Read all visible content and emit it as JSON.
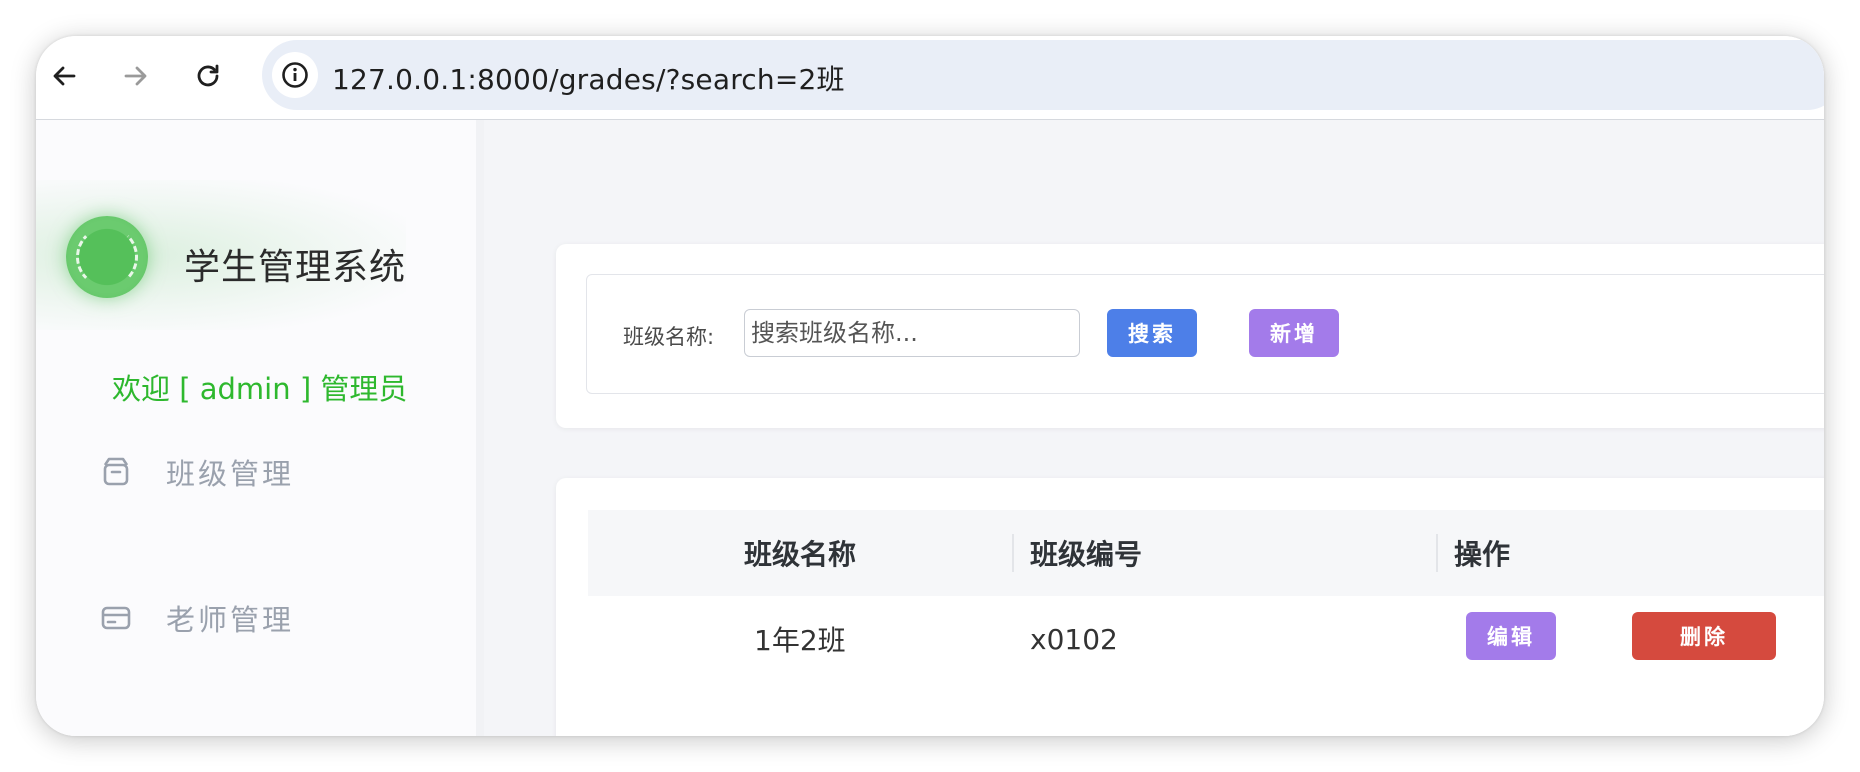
{
  "browser": {
    "url": "127.0.0.1:8000/grades/?search=2班",
    "icons": {
      "back": "arrow-left",
      "forward": "arrow-right",
      "reload": "reload",
      "info": "info-circle"
    }
  },
  "sidebar": {
    "brand": "学生管理系统",
    "welcome": "欢迎 [ admin ] 管理员",
    "items": [
      {
        "label": "班级管理",
        "icon": "archive-box"
      },
      {
        "label": "老师管理",
        "icon": "credit-card"
      }
    ]
  },
  "search": {
    "label": "班级名称:",
    "placeholder": "搜索班级名称...",
    "value": "",
    "search_button": "搜索",
    "add_button": "新增"
  },
  "table": {
    "headers": [
      "班级名称",
      "班级编号",
      "操作"
    ],
    "rows": [
      {
        "name": "1年2班",
        "code": "x0102",
        "edit": "编辑",
        "delete": "删除"
      }
    ]
  },
  "colors": {
    "accent_green": "#2eb82e",
    "search_blue": "#4d7fe8",
    "purple": "#a37bea",
    "danger_red": "#d54a3e",
    "annotation_red": "#ea3323"
  }
}
